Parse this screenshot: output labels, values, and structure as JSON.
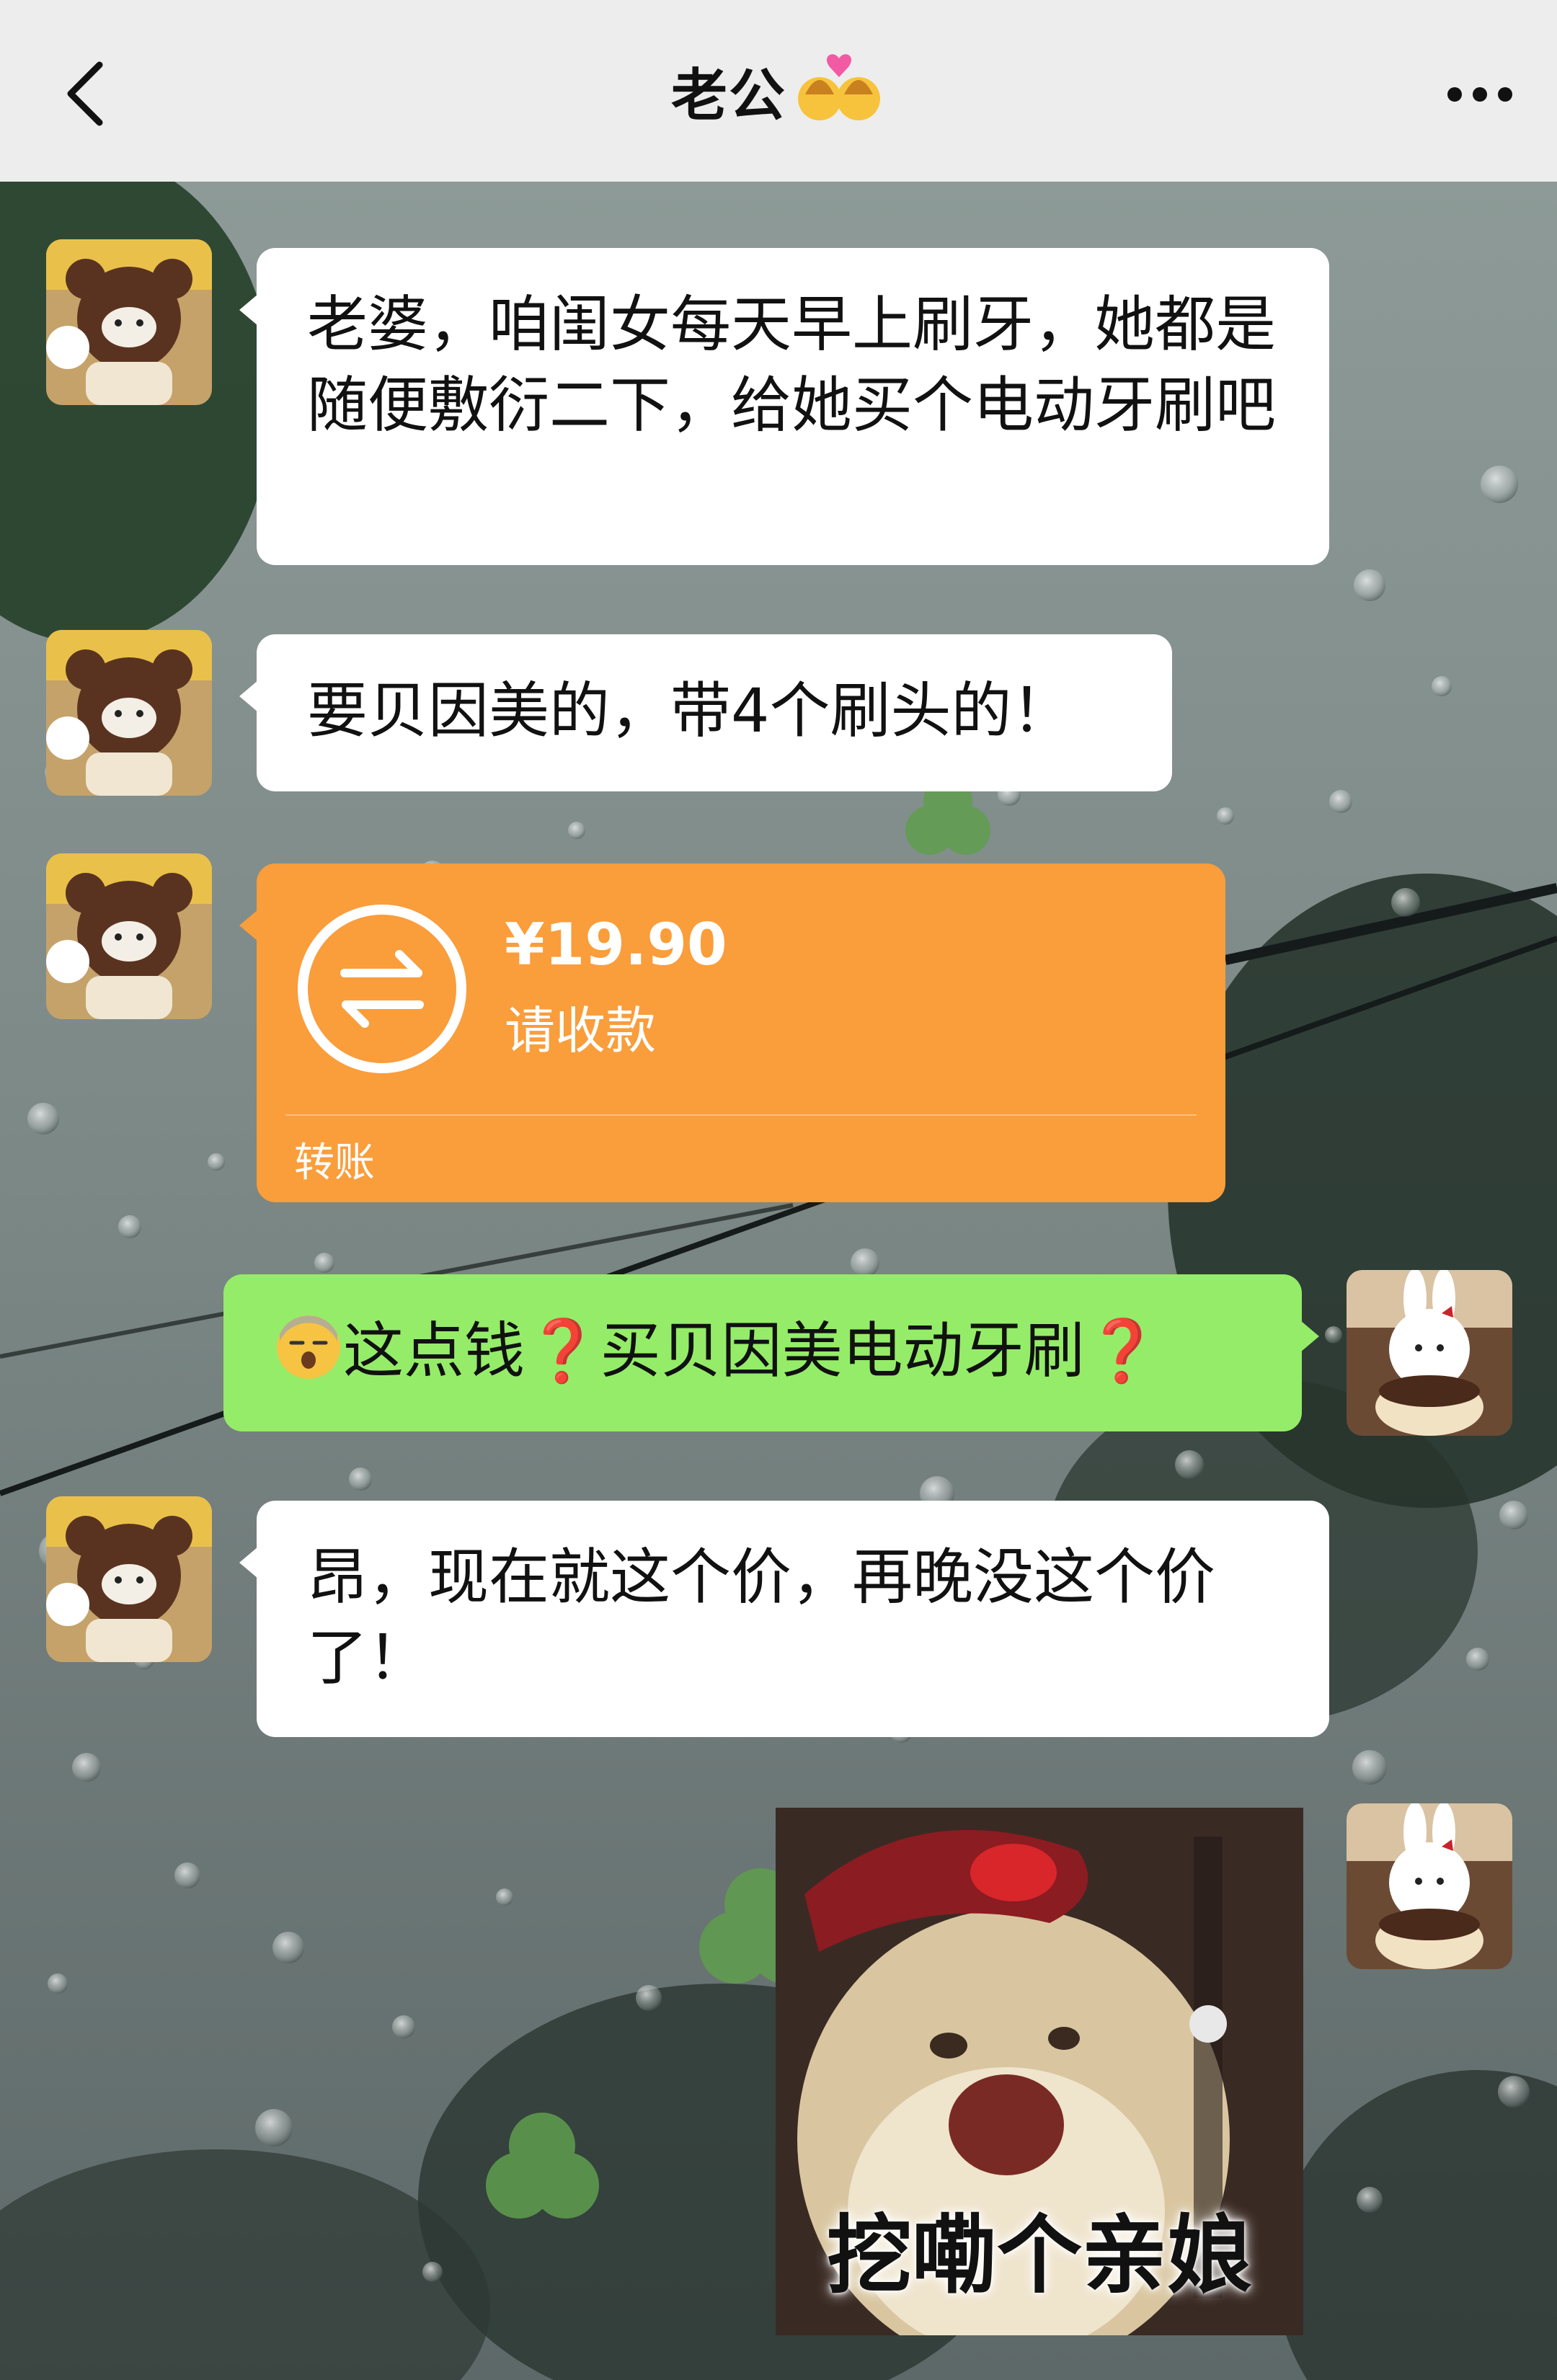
{
  "header": {
    "title": "老公",
    "title_emoji": "kiss-couple-emoji",
    "back_icon": "chevron-left-icon",
    "more_icon": "more-dots-icon"
  },
  "messages": [
    {
      "side": "left",
      "type": "text",
      "text": "老婆，咱闺女每天早上刷牙，她都是随便敷衍二下，给她买个电动牙刷吧"
    },
    {
      "side": "left",
      "type": "text",
      "text": "要贝因美的，带4个刷头的！"
    },
    {
      "side": "left",
      "type": "transfer",
      "amount": "¥19.90",
      "status": "请收款",
      "label": "转账"
    },
    {
      "side": "right",
      "type": "text",
      "emoji": "cold-sweat-emoji",
      "part1": "这点钱",
      "part2": "买贝因美电动牙刷",
      "mark": "❓"
    },
    {
      "side": "left",
      "type": "text",
      "text": "昂，现在就这个价，再晚没这个价了！"
    },
    {
      "side": "right",
      "type": "sticker",
      "caption": "挖嘞个亲娘"
    }
  ],
  "colors": {
    "header_bg": "#ededed",
    "left_bubble": "#ffffff",
    "right_bubble": "#95ec69",
    "transfer": "#fa9d3b",
    "question_mark": "#e3242b"
  }
}
